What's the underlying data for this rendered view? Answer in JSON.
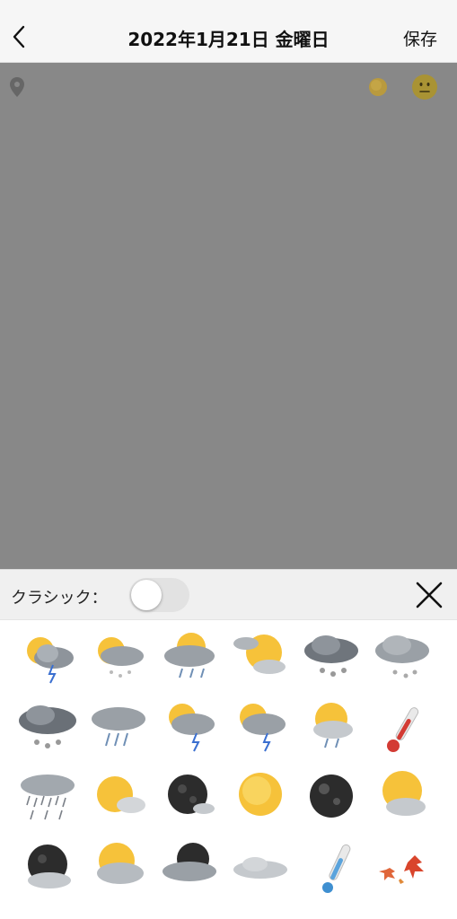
{
  "nav": {
    "back_icon": "chevron-left-icon",
    "title": "2022年1月21日 金曜日",
    "save_label": "保存"
  },
  "editor": {
    "background": "#888888",
    "location_icon": "location-pin-icon",
    "weather_icon": "sun-weather-icon",
    "mood_icon": "neutral-face-icon"
  },
  "picker": {
    "classic_label": "クラシック：",
    "classic_enabled": false,
    "close_icon": "close-icon"
  },
  "weather_icons": [
    [
      "sun-cloud-thunder-icon",
      "sun-cloud-snow-icon",
      "sun-cloud-rain-icon",
      "sun-partly-cloudy-icon",
      "cloud-snow-icon",
      "cloud-snow-light-icon"
    ],
    [
      "cloud-snow-heavy-icon",
      "cloud-rain-icon",
      "sun-cloud-thunder-icon",
      "sun-cloud-thunder-icon",
      "sun-cloud-rain-icon",
      "thermometer-hot-icon"
    ],
    [
      "cloud-rain-heavy-icon",
      "sun-cloud-icon",
      "moon-cloud-icon",
      "sun-icon",
      "moon-icon",
      "sun-cloud-icon"
    ],
    [
      "moon-cloud-icon",
      "sun-cloud-icon",
      "moon-cloud-icon",
      "cloud-icon",
      "thermometer-cold-icon",
      "autumn-leaves-icon"
    ]
  ]
}
